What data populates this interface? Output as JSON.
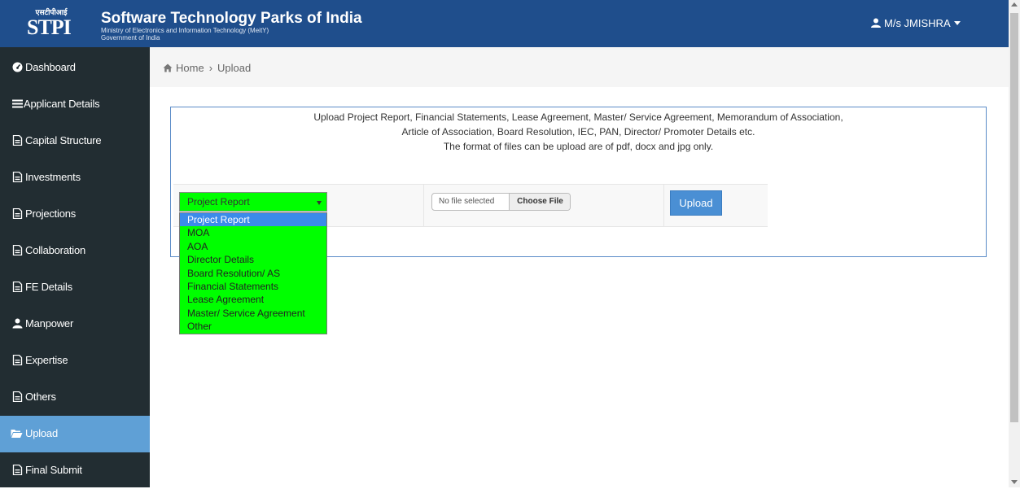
{
  "header": {
    "logo_hindi": "एसटीपीआई",
    "logo_text": "STPI",
    "title": "Software Technology Parks of India",
    "subtitle_line1": "Ministry of Electronics and Information Technology (MeitY)",
    "subtitle_line2": "Government of India",
    "user_label": "M/s JMISHRA",
    "background_color": "#1f4e8c"
  },
  "sidebar": {
    "background_color": "#222d32",
    "active_color": "#5fa0d6",
    "items": [
      {
        "label": "Dashboard",
        "icon": "dashboard-icon"
      },
      {
        "label": "Applicant Details",
        "icon": "bars-icon"
      },
      {
        "label": "Capital Structure",
        "icon": "document-icon"
      },
      {
        "label": "Investments",
        "icon": "document-icon"
      },
      {
        "label": "Projections",
        "icon": "document-icon"
      },
      {
        "label": "Collaboration",
        "icon": "document-icon"
      },
      {
        "label": "FE Details",
        "icon": "document-icon"
      },
      {
        "label": "Manpower",
        "icon": "users-icon"
      },
      {
        "label": "Expertise",
        "icon": "document-icon"
      },
      {
        "label": "Others",
        "icon": "document-icon"
      },
      {
        "label": "Upload",
        "icon": "folder-open-icon",
        "active": true
      },
      {
        "label": "Final Submit",
        "icon": "document-icon"
      }
    ]
  },
  "breadcrumb": {
    "home": "Home",
    "current": "Upload"
  },
  "main": {
    "instructions": [
      "Upload Project Report, Financial Statements, Lease Agreement, Master/ Service Agreement, Memorandum of Association,",
      "Article of Association, Board Resolution, IEC, PAN, Director/ Promoter Details etc.",
      "The format of files can be upload are of pdf, docx and jpg only."
    ],
    "document_type": {
      "selected": "Project Report",
      "options": [
        "Project Report",
        "MOA",
        "AOA",
        "Director Details",
        "Board Resolution/ AS",
        "Financial Statements",
        "Lease Agreement",
        "Master/ Service Agreement",
        "Other"
      ],
      "background_color": "#00ff00"
    },
    "file_input": {
      "status": "No file selected",
      "button_label": "Choose File"
    },
    "upload_button": "Upload"
  }
}
